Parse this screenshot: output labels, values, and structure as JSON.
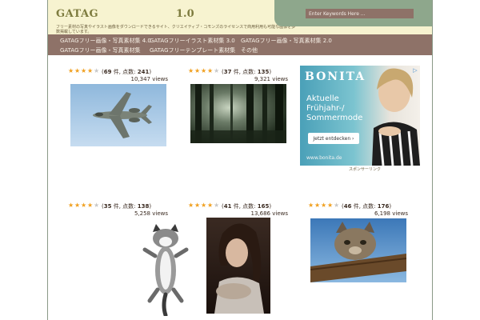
{
  "header": {
    "title": "GATAG",
    "version": "1.0",
    "tagline": "フリー素材の写真やイラスト画像をダウンロードできるサイト、クリエイティブ・コモンズのライセンスで商用利用も可能な画像を多数掲載しています。",
    "search_placeholder": "Enter Keywords Here ..."
  },
  "nav": {
    "items": [
      {
        "label": "GATAGフリー画像・写真素材集 4.0"
      },
      {
        "label": "GATAGフリーイラスト素材集 3.0"
      },
      {
        "label": "GATAGフリー画像・写真素材集 2.0"
      },
      {
        "label": "GATAGフリー画像・写真素材集"
      },
      {
        "label": "GATAGフリーテンプレート素材集"
      },
      {
        "label": "その他"
      }
    ]
  },
  "thumbnails": [
    {
      "rating": 4,
      "votes": "69",
      "sep": "件, 点数:",
      "score": "241",
      "views": "10,347 views",
      "subject": "fighter-jet"
    },
    {
      "rating": 4,
      "votes": "37",
      "sep": "件, 点数:",
      "score": "135",
      "views": "9,321 views",
      "subject": "forest-light"
    },
    {
      "rating": 4,
      "votes": "35",
      "sep": "件, 点数:",
      "score": "138",
      "views": "5,258 views",
      "subject": "kitten-jumping"
    },
    {
      "rating": 4,
      "votes": "41",
      "sep": "件, 点数:",
      "score": "165",
      "views": "13,686 views",
      "subject": "woman-portrait"
    },
    {
      "rating": 4,
      "votes": "46",
      "sep": "件, 点数:",
      "score": "176",
      "views": "6,198 views",
      "subject": "cat-on-log"
    }
  ],
  "ad": {
    "brand": "BONITA",
    "headline": "Aktuelle Frühjahr-/ Sommermode",
    "button": "Jetzt entdecken ›",
    "url": "www.bonita.de",
    "caption": "スポンサーリンク"
  }
}
